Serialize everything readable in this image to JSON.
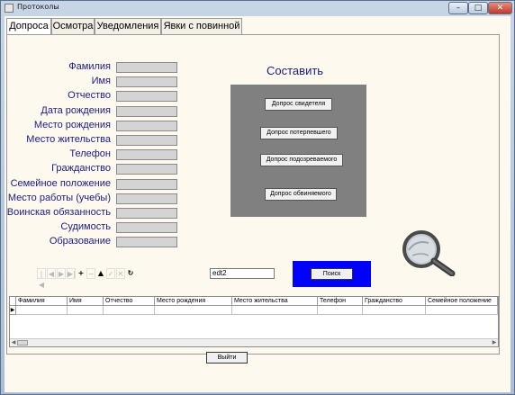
{
  "window": {
    "title": "Протоколы"
  },
  "tabs": [
    {
      "label": "Допроса"
    },
    {
      "label": "Осмотра"
    },
    {
      "label": "Уведомления"
    },
    {
      "label": "Явки с повинной"
    }
  ],
  "form": {
    "fields": [
      {
        "label": "Фамилия"
      },
      {
        "label": "Имя"
      },
      {
        "label": "Отчество"
      },
      {
        "label": "Дата рождения"
      },
      {
        "label": "Место рождения"
      },
      {
        "label": "Место жительства"
      },
      {
        "label": "Телефон"
      },
      {
        "label": "Гражданство"
      },
      {
        "label": "Семейное положение"
      },
      {
        "label": "Место работы (учебы)"
      },
      {
        "label": "Воинская обязанность"
      },
      {
        "label": "Судимость"
      },
      {
        "label": "Образование"
      }
    ]
  },
  "compose": {
    "title": "Составить",
    "buttons": [
      {
        "label": "Допрос свидетеля"
      },
      {
        "label": "Допрос потерпевшего"
      },
      {
        "label": "Допрос подозреваемого"
      },
      {
        "label": "Допрос обвиняемого"
      }
    ]
  },
  "navigator": {
    "buttons": [
      {
        "glyph": "|◀",
        "name": "first-record-button",
        "enabled": false
      },
      {
        "glyph": "◀",
        "name": "prior-record-button",
        "enabled": false
      },
      {
        "glyph": "▶",
        "name": "next-record-button",
        "enabled": false
      },
      {
        "glyph": "▶|",
        "name": "last-record-button",
        "enabled": false
      },
      {
        "glyph": "+",
        "name": "insert-record-button",
        "enabled": true
      },
      {
        "glyph": "−",
        "name": "delete-record-button",
        "enabled": false
      },
      {
        "glyph": "▲",
        "name": "edit-record-button",
        "enabled": true
      },
      {
        "glyph": "✓",
        "name": "post-record-button",
        "enabled": false
      },
      {
        "glyph": "✕",
        "name": "cancel-record-button",
        "enabled": false
      },
      {
        "glyph": "↻",
        "name": "refresh-button",
        "enabled": true
      }
    ]
  },
  "search": {
    "input_value": "edt2",
    "button_label": "Поиск"
  },
  "grid": {
    "columns": [
      "Фамилия",
      "Имя",
      "Отчество",
      "Место рождения",
      "Место жительства",
      "Телефон",
      "Гражданство",
      "Семейное положение"
    ],
    "row_indicator": "▶"
  },
  "footer": {
    "exit_label": "Выйти"
  }
}
